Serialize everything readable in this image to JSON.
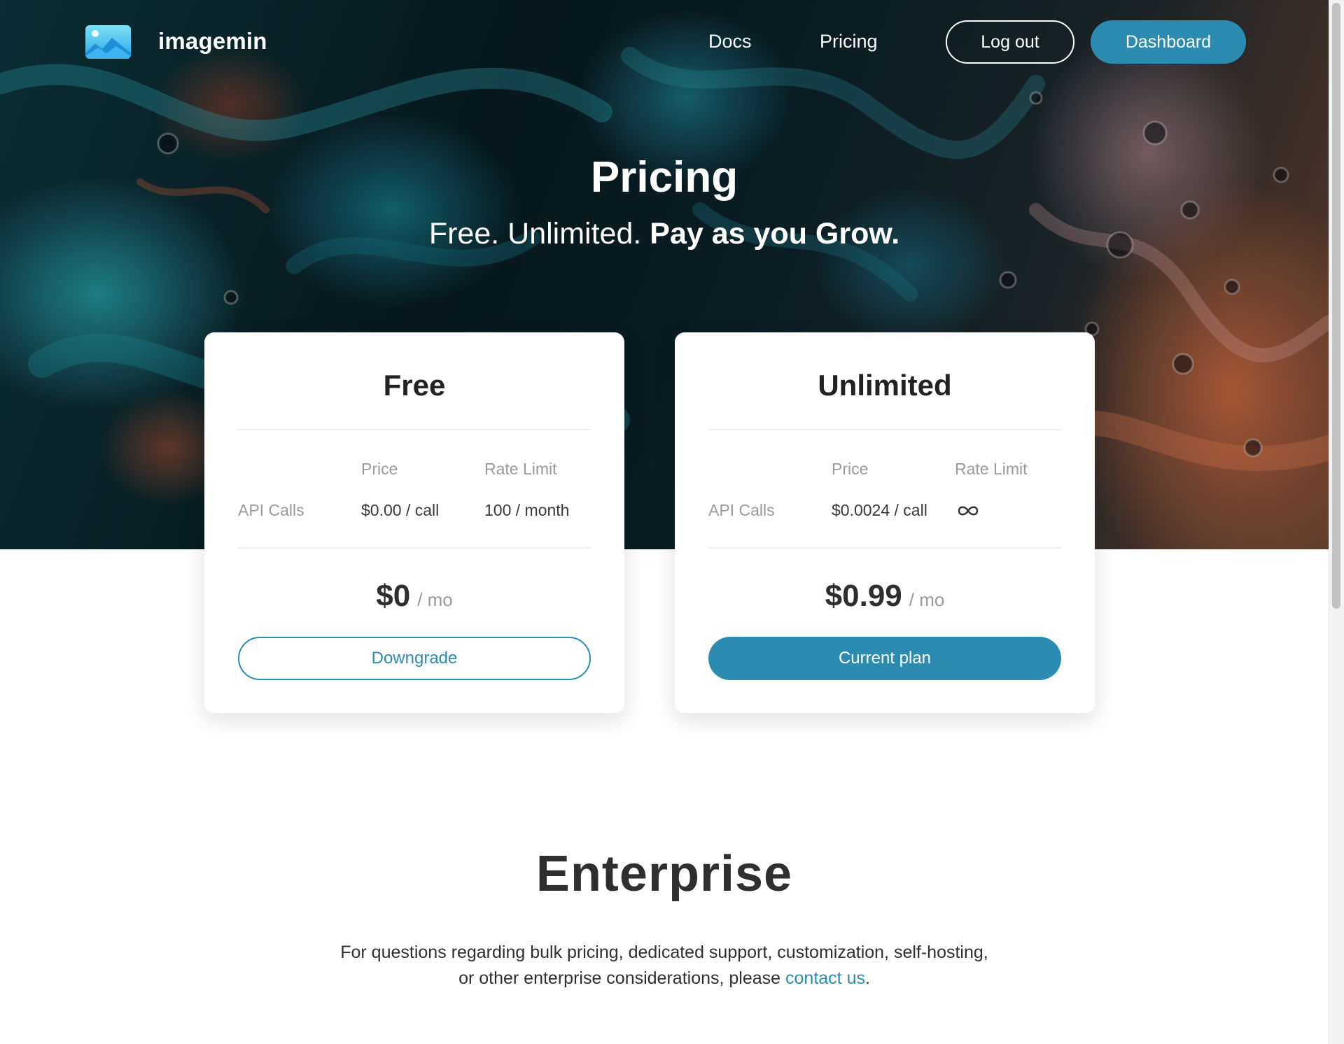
{
  "colors": {
    "accent": "#2c8bb0",
    "text": "#2b2b2b",
    "muted": "#9a9a9a"
  },
  "header": {
    "brand": "imagemin",
    "logo_icon": "image-icon",
    "nav": {
      "docs": "Docs",
      "pricing": "Pricing"
    },
    "logout_label": "Log out",
    "dashboard_label": "Dashboard"
  },
  "hero": {
    "title": "Pricing",
    "subtitle_plain": "Free. Unlimited. ",
    "subtitle_bold": "Pay as you Grow."
  },
  "plans": [
    {
      "name": "Free",
      "col_price": "Price",
      "col_rate": "Rate Limit",
      "row_label": "API Calls",
      "price_per_call": "$0.00 / call",
      "rate_limit": "100 / month",
      "amount": "$0",
      "period": "/ mo",
      "button_label": "Downgrade"
    },
    {
      "name": "Unlimited",
      "col_price": "Price",
      "col_rate": "Rate Limit",
      "row_label": "API Calls",
      "price_per_call": "$0.0024 / call",
      "rate_limit_icon": "infinity-icon",
      "amount": "$0.99",
      "period": "/ mo",
      "button_label": "Current plan"
    }
  ],
  "enterprise": {
    "title": "Enterprise",
    "text": "For questions regarding bulk pricing, dedicated support, customization, self-hosting, or other enterprise considerations, please ",
    "link_label": "contact us",
    "text_end": "."
  }
}
